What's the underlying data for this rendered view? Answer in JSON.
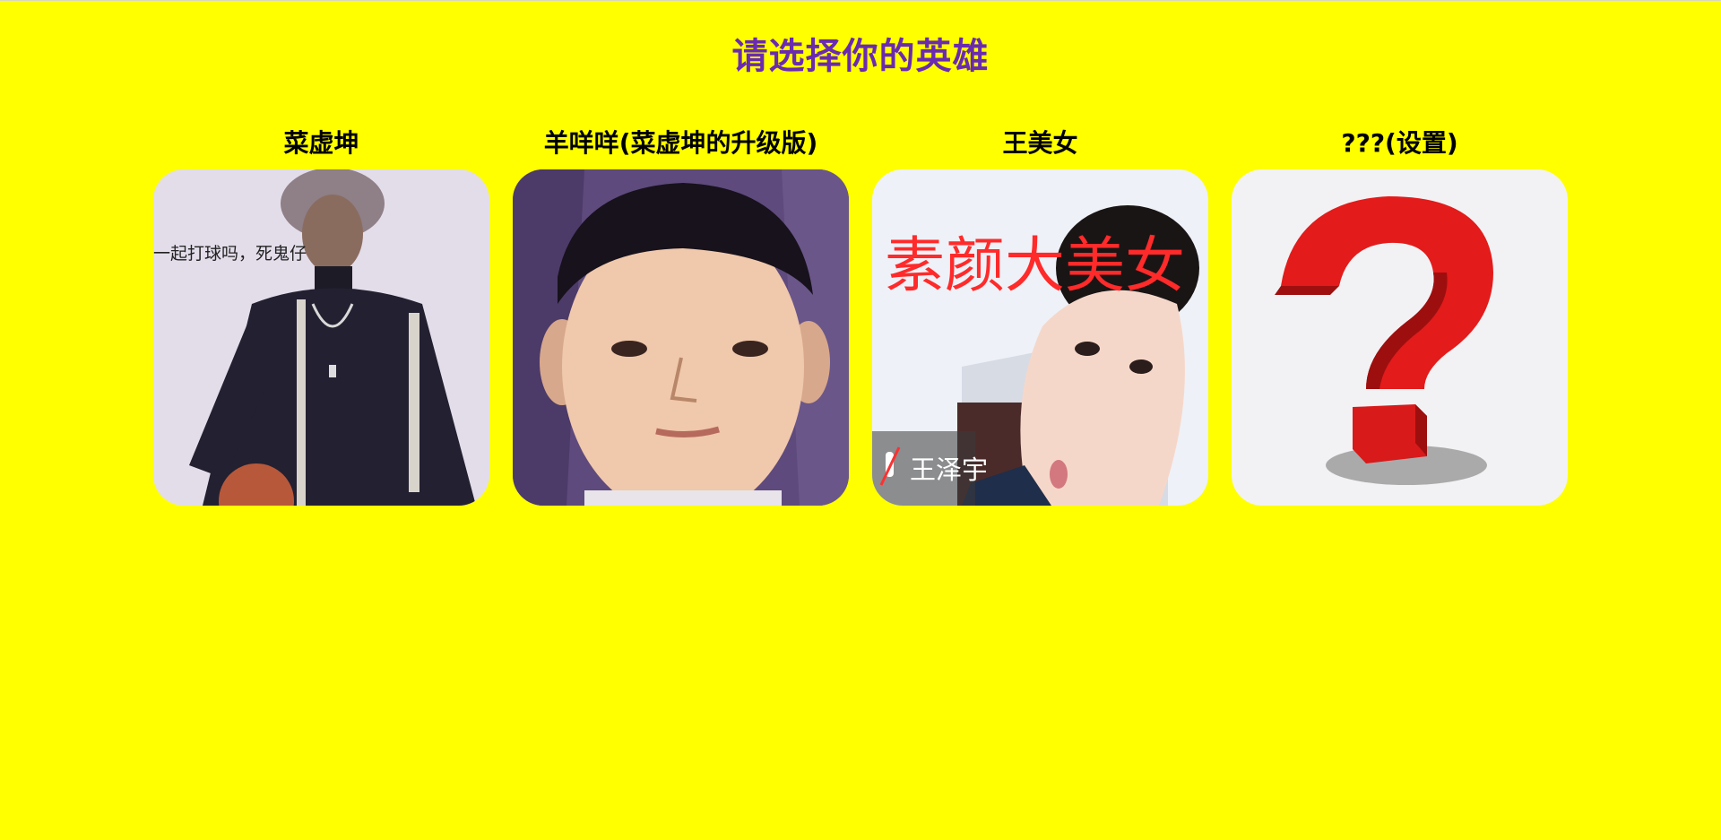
{
  "page": {
    "title": "请选择你的英雄"
  },
  "heroes": [
    {
      "name": "菜虚坤",
      "icon": "portrait-photo",
      "caption": "一起打球吗，死鬼仔"
    },
    {
      "name": "羊咩咩(菜虚坤的升级版)",
      "icon": "portrait-photo"
    },
    {
      "name": "王美女",
      "icon": "portrait-photo",
      "caption": "素颜大美女",
      "tag": "王泽宇"
    },
    {
      "name": "???(设置)",
      "icon": "question-mark-icon"
    }
  ],
  "colors": {
    "background": "#ffff00",
    "title": "#6a2bb0",
    "hero_name": "#000000",
    "caption_red": "#ff2a2a"
  }
}
